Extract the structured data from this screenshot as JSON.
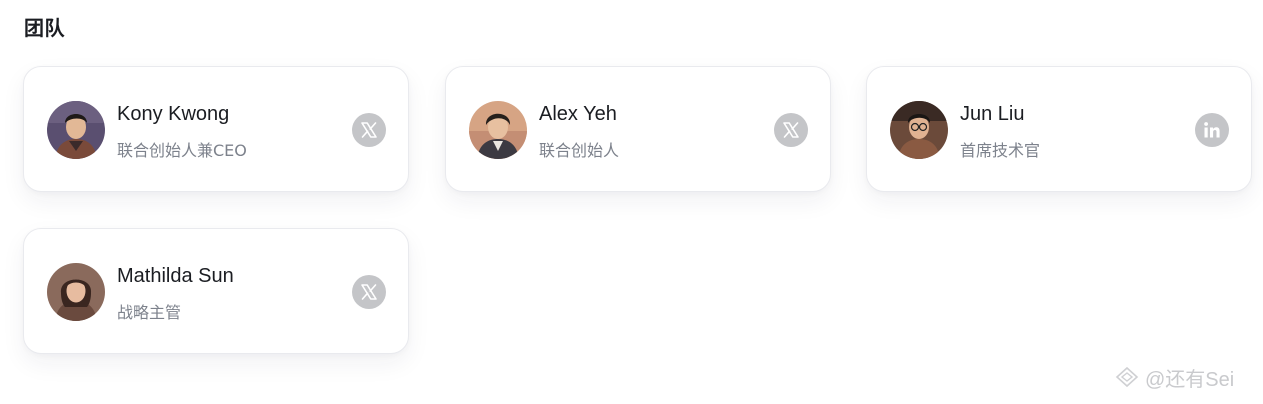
{
  "section": {
    "title": "团队"
  },
  "members": [
    {
      "name": "Kony Kwong",
      "role": "联合创始人兼CEO",
      "social": "x-icon"
    },
    {
      "name": "Alex Yeh",
      "role": "联合创始人",
      "social": "x-icon"
    },
    {
      "name": "Jun Liu",
      "role": "首席技术官",
      "social": "linkedin-icon"
    },
    {
      "name": "Mathilda Sun",
      "role": "战略主管",
      "social": "x-icon"
    }
  ],
  "watermark": {
    "text": "@还有Sei"
  },
  "colors": {
    "card_border": "#e9eaee",
    "name_text": "#1b1d22",
    "role_text": "#7d828c",
    "social_icon_bg": "#c4c5c8"
  }
}
